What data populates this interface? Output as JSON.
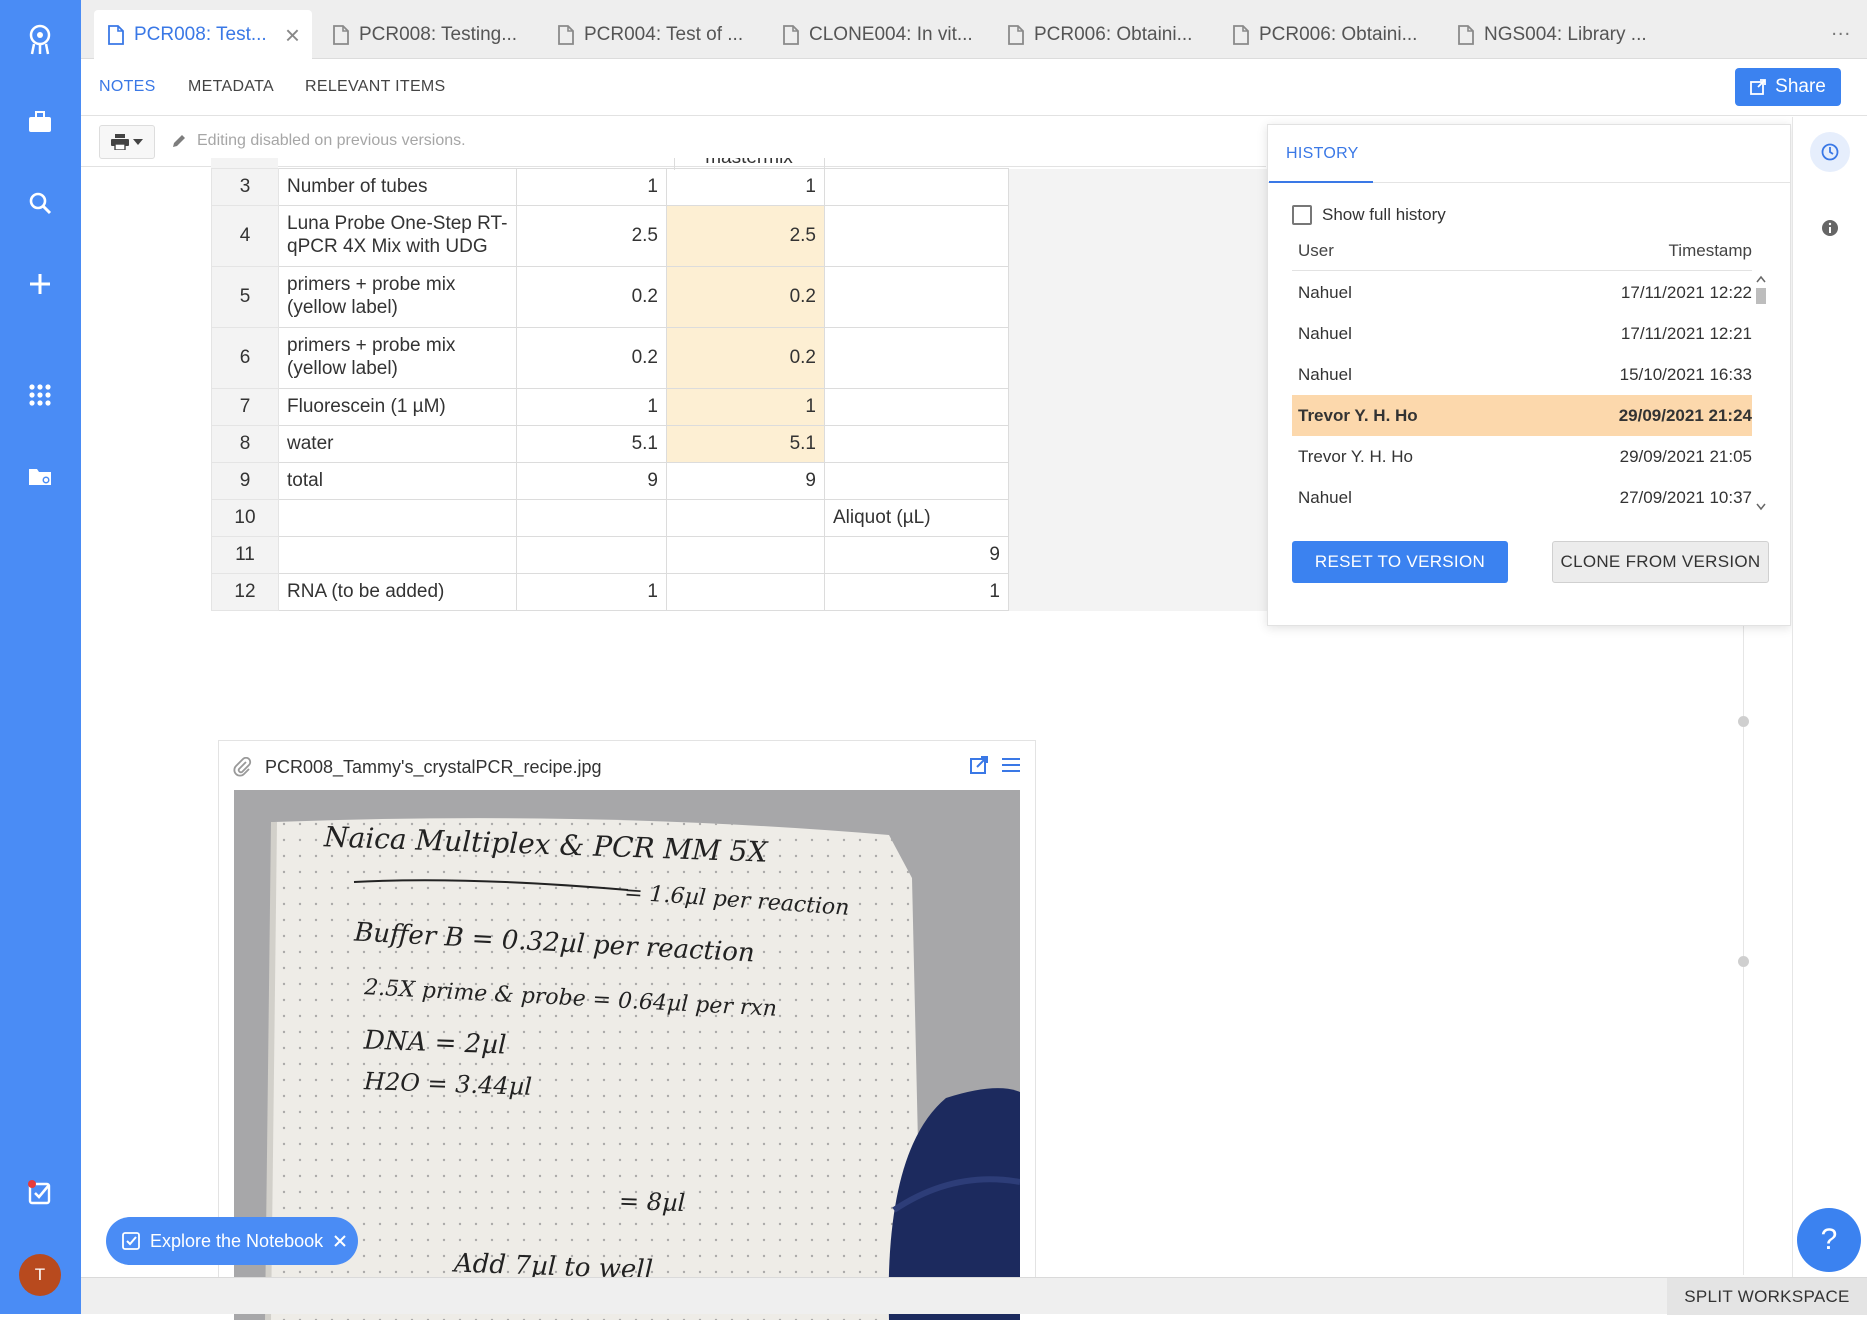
{
  "tabs": [
    {
      "label": "PCR008: Test...",
      "active": true
    },
    {
      "label": "PCR008: Testing...",
      "active": false
    },
    {
      "label": "PCR004: Test of ...",
      "active": false
    },
    {
      "label": "CLONE004: In vit...",
      "active": false
    },
    {
      "label": "PCR006: Obtaini...",
      "active": false
    },
    {
      "label": "PCR006: Obtaini...",
      "active": false
    },
    {
      "label": "NGS004: Library ...",
      "active": false
    }
  ],
  "tabbar": {
    "more": "..."
  },
  "subnav": {
    "notes": "NOTES",
    "metadata": "METADATA",
    "relevant": "RELEVANT ITEMS",
    "share": "Share"
  },
  "toolbar": {
    "edit_note": "Editing disabled on previous versions."
  },
  "sheet": {
    "partial_text": "mastermix",
    "rows": [
      {
        "n": "3",
        "c1": "Number of tubes",
        "c2": "1",
        "c3": "1",
        "c4": ""
      },
      {
        "n": "4",
        "c1": "Luna Probe One-Step RT-qPCR 4X Mix with UDG",
        "c2": "2.5",
        "c3": "2.5",
        "c4": ""
      },
      {
        "n": "5",
        "c1": "primers + probe mix (yellow label)",
        "c2": "0.2",
        "c3": "0.2",
        "c4": ""
      },
      {
        "n": "6",
        "c1": "primers + probe mix (yellow label)",
        "c2": "0.2",
        "c3": "0.2",
        "c4": ""
      },
      {
        "n": "7",
        "c1": "Fluorescein (1 µM)",
        "c2": "1",
        "c3": "1",
        "c4": ""
      },
      {
        "n": "8",
        "c1": "water",
        "c2": "5.1",
        "c3": "5.1",
        "c4": ""
      },
      {
        "n": "9",
        "c1": "total",
        "c2": "9",
        "c3": "9",
        "c4": ""
      },
      {
        "n": "10",
        "c1": "",
        "c2": "",
        "c3": "",
        "c4": "Aliquot (µL)"
      },
      {
        "n": "11",
        "c1": "",
        "c2": "",
        "c3": "",
        "c4": "9"
      },
      {
        "n": "12",
        "c1": "RNA (to be added)",
        "c2": "1",
        "c3": "",
        "c4": "1"
      }
    ]
  },
  "attachment": {
    "filename": "PCR008_Tammy's_crystalPCR_recipe.jpg",
    "note_lines": [
      "Naica Multiplex & PCR MM 5X",
      "= 1.6µl per reaction",
      "Buffer B      = 0.32µl per reaction",
      "2.5X prime & probe  = 0.64µl per rxn",
      "DNA        = 2µl",
      "H2O        = 3.44µl",
      "= 8µl",
      "Add 7µl to well"
    ]
  },
  "history": {
    "tab": "HISTORY",
    "show_full": "Show full history",
    "col_user": "User",
    "col_timestamp": "Timestamp",
    "rows": [
      {
        "user": "Nahuel",
        "ts": "17/11/2021 12:22",
        "selected": false
      },
      {
        "user": "Nahuel",
        "ts": "17/11/2021 12:21",
        "selected": false
      },
      {
        "user": "Nahuel",
        "ts": "15/10/2021 16:33",
        "selected": false
      },
      {
        "user": "Trevor Y. H. Ho",
        "ts": "29/09/2021 21:24",
        "selected": true
      },
      {
        "user": "Trevor Y. H. Ho",
        "ts": "29/09/2021 21:05",
        "selected": false
      },
      {
        "user": "Nahuel",
        "ts": "27/09/2021 10:37",
        "selected": false
      }
    ],
    "reset": "RESET TO VERSION",
    "clone": "CLONE FROM VERSION"
  },
  "bottom": {
    "split": "SPLIT WORKSPACE",
    "explore": "Explore the Notebook"
  },
  "help": "?",
  "avatar": "T",
  "colors": {
    "sidebar": "#4a8cf5",
    "accent": "#3b82f0",
    "highlight": "#fdefd3",
    "selected_row": "#fcd8ac"
  },
  "icons": [
    "app-logo-icon",
    "briefcase-icon",
    "search-icon",
    "plus-icon",
    "apps-grid-icon",
    "folder-icon",
    "tasks-check-icon",
    "document-icon",
    "print-icon",
    "pencil-icon",
    "paperclip-icon",
    "clock-icon",
    "info-icon"
  ]
}
